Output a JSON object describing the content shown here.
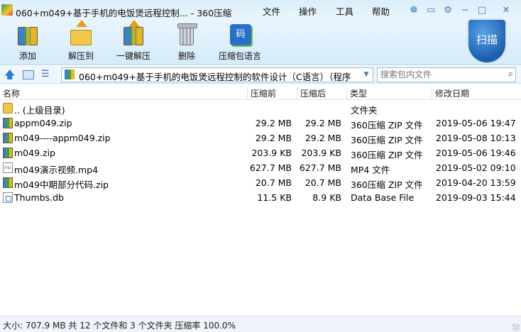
{
  "window": {
    "title": "060+m049+基于手机的电饭煲远程控制... - 360压缩",
    "menu": [
      "文件",
      "操作",
      "工具",
      "帮助"
    ]
  },
  "toolbar": {
    "items": [
      {
        "label": "添加",
        "icon": "add-archive-icon"
      },
      {
        "label": "解压到",
        "icon": "extract-to-icon"
      },
      {
        "label": "一键解压",
        "icon": "one-click-extract-icon"
      },
      {
        "label": "删除",
        "icon": "delete-trash-icon"
      },
      {
        "label": "压缩包语言",
        "icon": "archive-language-icon"
      }
    ],
    "scan_label": "扫描"
  },
  "address": {
    "path": "060+m049+基于手机的电饭煲远程控制的软件设计（C语言）（程序，",
    "search_placeholder": "搜索包内文件"
  },
  "columns": {
    "name": "名称",
    "packed": "压缩前",
    "unpacked": "压缩后",
    "type": "类型",
    "modified": "修改日期"
  },
  "files": [
    {
      "name": ".. (上级目录)",
      "packed": "",
      "unpacked": "",
      "type": "文件夹",
      "modified": "",
      "icon": "up"
    },
    {
      "name": "appm049.zip",
      "packed": "29.2 MB",
      "unpacked": "29.2 MB",
      "type": "360压缩 ZIP 文件",
      "modified": "2019-05-06 19:47",
      "icon": "zip"
    },
    {
      "name": "m049----appm049.zip",
      "packed": "29.2 MB",
      "unpacked": "29.2 MB",
      "type": "360压缩 ZIP 文件",
      "modified": "2019-05-08 10:13",
      "icon": "zip"
    },
    {
      "name": "m049.zip",
      "packed": "203.9 KB",
      "unpacked": "203.9 KB",
      "type": "360压缩 ZIP 文件",
      "modified": "2019-05-06 19:46",
      "icon": "zip"
    },
    {
      "name": "m049演示视频.mp4",
      "packed": "627.7 MB",
      "unpacked": "627.7 MB",
      "type": "MP4 文件",
      "modified": "2019-05-02 09:10",
      "icon": "doc"
    },
    {
      "name": "m049中期部分代码.zip",
      "packed": "20.7 MB",
      "unpacked": "20.7 MB",
      "type": "360压缩 ZIP 文件",
      "modified": "2019-04-20 13:59",
      "icon": "zip"
    },
    {
      "name": "Thumbs.db",
      "packed": "11.5 KB",
      "unpacked": "8.9 KB",
      "type": "Data Base File",
      "modified": "2019-09-03 15:44",
      "icon": "db"
    }
  ],
  "status": "大小: 707.9 MB 共 12 个文件和 3 个文件夹 压缩率 100.0%"
}
